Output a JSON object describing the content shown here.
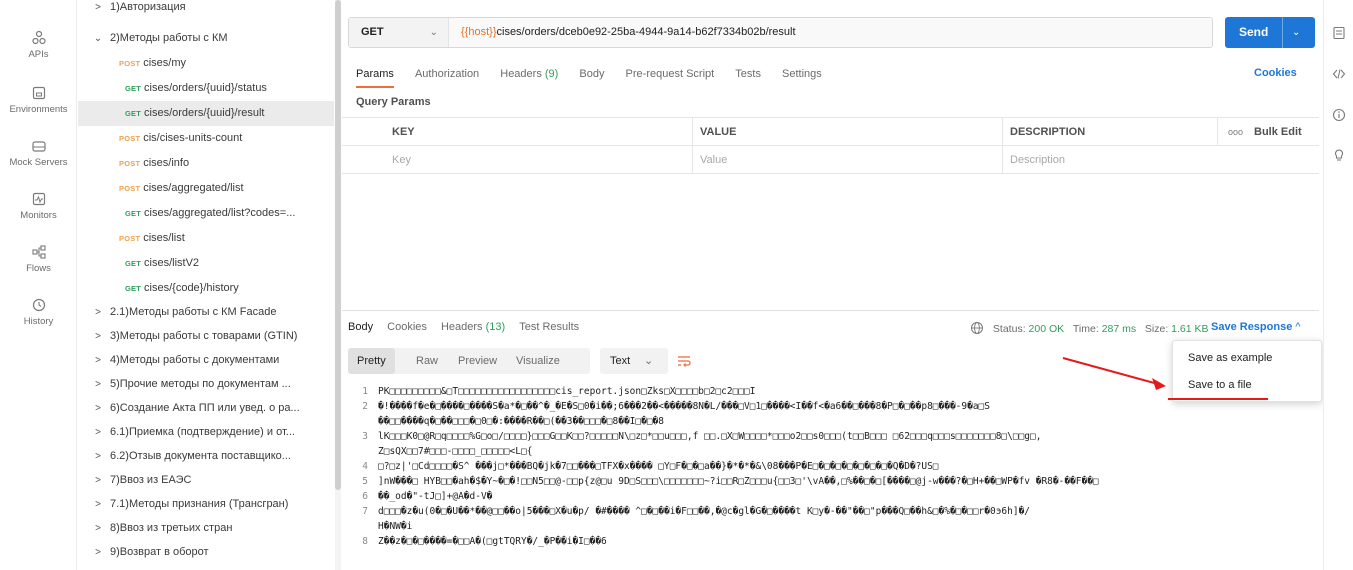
{
  "sidebar_rail": {
    "items": [
      {
        "label": "APIs",
        "icon": "apis-icon"
      },
      {
        "label": "Environments",
        "icon": "environments-icon"
      },
      {
        "label": "Mock Servers",
        "icon": "mock-servers-icon"
      },
      {
        "label": "Monitors",
        "icon": "monitors-icon"
      },
      {
        "label": "Flows",
        "icon": "flows-icon"
      },
      {
        "label": "History",
        "icon": "history-icon"
      }
    ]
  },
  "tree": {
    "rows": [
      {
        "kind": "folder",
        "expanded": false,
        "label": "1)Авторизация"
      },
      {
        "kind": "folder",
        "expanded": true,
        "label": "2)Методы работы с КМ"
      },
      {
        "kind": "request",
        "method": "POST",
        "label": "cises/my"
      },
      {
        "kind": "request",
        "method": "GET",
        "label": "cises/orders/{uuid}/status"
      },
      {
        "kind": "request",
        "method": "GET",
        "label": "cises/orders/{uuid}/result",
        "selected": true
      },
      {
        "kind": "request",
        "method": "POST",
        "label": "cis/cises-units-count"
      },
      {
        "kind": "request",
        "method": "POST",
        "label": "cises/info"
      },
      {
        "kind": "request",
        "method": "POST",
        "label": "cises/aggregated/list"
      },
      {
        "kind": "request",
        "method": "GET",
        "label": "cises/aggregated/list?codes=..."
      },
      {
        "kind": "request",
        "method": "POST",
        "label": "cises/list"
      },
      {
        "kind": "request",
        "method": "GET",
        "label": "cises/listV2"
      },
      {
        "kind": "request",
        "method": "GET",
        "label": "cises/{code}/history"
      },
      {
        "kind": "folder",
        "expanded": false,
        "label": "2.1)Методы работы с КМ Facade"
      },
      {
        "kind": "folder",
        "expanded": false,
        "label": "3)Методы работы с товарами (GTIN)"
      },
      {
        "kind": "folder",
        "expanded": false,
        "label": "4)Методы работы с документами"
      },
      {
        "kind": "folder",
        "expanded": false,
        "label": "5)Прочие методы по документам ..."
      },
      {
        "kind": "folder",
        "expanded": false,
        "label": "6)Создание Акта ПП или увед. о ра..."
      },
      {
        "kind": "folder",
        "expanded": false,
        "label": "6.1)Приемка (подтверждение) и от..."
      },
      {
        "kind": "folder",
        "expanded": false,
        "label": "6.2)Отзыв документа поставщико..."
      },
      {
        "kind": "folder",
        "expanded": false,
        "label": "7)Ввоз из ЕАЭС"
      },
      {
        "kind": "folder",
        "expanded": false,
        "label": "7.1)Методы признания (Трансгран)"
      },
      {
        "kind": "folder",
        "expanded": false,
        "label": "8)Ввоз из третьих стран"
      },
      {
        "kind": "folder",
        "expanded": false,
        "label": "9)Возврат в оборот"
      }
    ]
  },
  "request": {
    "method": "GET",
    "url_var": "{{host}}",
    "url_rest": "cises/orders/dceb0e92-25ba-4944-9a14-b62f7334b02b/result",
    "send_label": "Send"
  },
  "req_tabs": [
    {
      "label": "Params",
      "active": true
    },
    {
      "label": "Authorization"
    },
    {
      "label": "Headers",
      "count": "(9)"
    },
    {
      "label": "Body"
    },
    {
      "label": "Pre-request Script"
    },
    {
      "label": "Tests"
    },
    {
      "label": "Settings"
    }
  ],
  "cookies_label": "Cookies",
  "query_params": {
    "title": "Query Params",
    "headers": {
      "key": "KEY",
      "value": "VALUE",
      "description": "DESCRIPTION",
      "bulk_edit": "Bulk Edit",
      "more": "ooo"
    },
    "placeholders": {
      "key": "Key",
      "value": "Value",
      "description": "Description"
    }
  },
  "response": {
    "tabs": [
      {
        "label": "Body",
        "active": true
      },
      {
        "label": "Cookies"
      },
      {
        "label": "Headers",
        "count": "(13)"
      },
      {
        "label": "Test Results"
      }
    ],
    "status_label": "Status:",
    "status_value": "200 OK",
    "time_label": "Time:",
    "time_value": "287 ms",
    "size_label": "Size:",
    "size_value": "1.61 KB",
    "save_response": "Save Response",
    "format": {
      "modes": [
        "Pretty",
        "Raw",
        "Preview",
        "Visualize"
      ],
      "active": "Pretty",
      "type": "Text"
    },
    "lines": [
      {
        "n": "1",
        "text": "PK□□□□□□□□□&□T□□□□□□□□□□□□□□□□□cis_report.json□Zks□X□□□□b□2□c2□□□I"
      },
      {
        "n": "2",
        "text": "�!����f�e�□����□����S�a*�□��^�_�E�S□0�i��;6���2��<�����8N�L/���□V□1□����<I��f<�a6��□���8�P□�□��p8□���-9�a□S"
      },
      {
        "n": "",
        "text": "  ��□□����q�□��□□□�□0□�:����R��□(��3��□□□�□8��I□�□�8"
      },
      {
        "n": "3",
        "text": "lK□□□K0□@R□q□□□□%G□o□/□□□□}□□□G□□K□□?□□□□□N\\□z□*□□u□□□,f    □□.□X□W□□□□*□□□o2□□s0□□□(t□□B□□□ □62□□□q□□□s□□□□□□□8□\\□□g□,"
      },
      {
        "n": "",
        "text": "  Z□sQX□□7#□□□-□□□□_□□□□□<L□{"
      },
      {
        "n": "4",
        "text": "□?□z|'□Cd□□□□�S^ ���j□*���BQ�jk�7□□���□TFX�x���� □Y□F�□�□a��}�*�*�&\\08���P�E□�□�□�□�□�□�□�Q�D�?US□"
      },
      {
        "n": "5",
        "text": "]nW���□ HYB□□�ah�$�Y~�□�!□□N5□□@-□□p{z@□u 9D□S□□□\\□□□□□□□~?i□□R□Z□□□u{□□3□'\\vA��,□%��□�□[����□@j-w���?�□H+��□WP�fv �R8�-��F��□"
      },
      {
        "n": "6",
        "text": "��_od�\"-tJ□]+@A�d-V�"
      },
      {
        "n": "7",
        "text": "d□□□�z�u(0�□�U��*��@□□��o|5���□X�u�p/ �#���� ^□�□��i�F□□��,�@c�gl�G�□����t K□y�-��\"��□\"p���Q□��h&□�%�□�□□r�0э6h]�/"
      },
      {
        "n": "",
        "text": "  H�NW�i"
      },
      {
        "n": "8",
        "text": "Z��z�□�□����=�□□A�(□gtTQRY�/_�P��i�I□��6"
      }
    ]
  },
  "save_menu": {
    "items": [
      "Save as example",
      "Save to a file"
    ]
  },
  "colors": {
    "accent_blue": "#1e77d6",
    "post": "#f0a24b",
    "get": "#2f9e5a",
    "active_tab": "#f26b3a",
    "annotation_red": "#e31b1b"
  }
}
